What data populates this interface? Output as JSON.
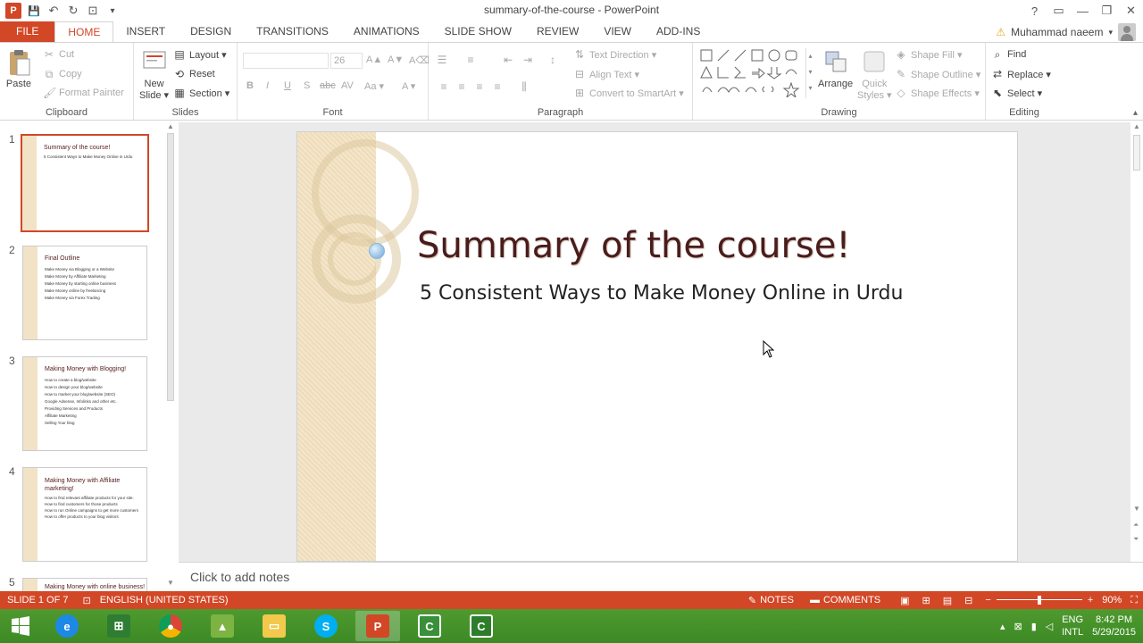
{
  "window": {
    "title": "summary-of-the-course - PowerPoint",
    "help": "?",
    "ribbon_display": "▭",
    "minimize": "—",
    "restore": "❐",
    "close": "✕"
  },
  "qat": {
    "save": "💾",
    "undo": "↶",
    "redo": "↻",
    "presenter": "⊡",
    "customize": "▾"
  },
  "tabs": [
    "FILE",
    "HOME",
    "INSERT",
    "DESIGN",
    "TRANSITIONS",
    "ANIMATIONS",
    "SLIDE SHOW",
    "REVIEW",
    "VIEW",
    "ADD-INS"
  ],
  "user": {
    "warning": "⚠",
    "name": "Muhammad naeem",
    "dropdown": "▾"
  },
  "ribbon": {
    "clipboard": {
      "label": "Clipboard",
      "paste": "Paste",
      "cut": "Cut",
      "copy": "Copy",
      "format_painter": "Format Painter"
    },
    "slides": {
      "label": "Slides",
      "new_slide": "New",
      "new_slide2": "Slide ▾",
      "layout": "Layout ▾",
      "reset": "Reset",
      "section": "Section ▾"
    },
    "font": {
      "label": "Font",
      "size": "26",
      "bold": "B",
      "italic": "I",
      "underline": "U",
      "shadow": "S",
      "strike": "abc",
      "spacing": "AV",
      "case": "Aa ▾",
      "color": "A ▾",
      "grow": "A▲",
      "shrink": "A▼",
      "clear": "A⌫"
    },
    "paragraph": {
      "label": "Paragraph",
      "text_direction": "Text Direction ▾",
      "align_text": "Align Text ▾",
      "smartart": "Convert to SmartArt ▾"
    },
    "drawing": {
      "label": "Drawing",
      "arrange": "Arrange",
      "quick_styles": "Quick",
      "quick_styles2": "Styles ▾",
      "shape_fill": "Shape Fill ▾",
      "shape_outline": "Shape Outline ▾",
      "shape_effects": "Shape Effects ▾"
    },
    "editing": {
      "label": "Editing",
      "find": "Find",
      "replace": "Replace ▾",
      "select": "Select ▾"
    }
  },
  "thumbnails": [
    {
      "num": "1",
      "title": "Summary of the course!",
      "lines": [
        "5 Consistent Ways to Make Money Online in Urdu"
      ]
    },
    {
      "num": "2",
      "title": "Final Outline",
      "lines": [
        "Make Money via Blogging or a Website",
        "Make Money by Affiliate Marketing",
        "Make Money by starting online business",
        "Make Money online by freelancing",
        "Make Money via Forex Trading"
      ]
    },
    {
      "num": "3",
      "title": "Making Money with Blogging!",
      "lines": [
        "How to create a blog/website",
        "How to design your blog/website",
        "How to market your blog/website (SEO)",
        "Google Adsense, Infolinks and other etc.",
        "Providing Services and Products",
        "Affiliate Marketing",
        "Selling Your blog"
      ]
    },
    {
      "num": "4",
      "title": "Making Money with Affiliate marketing!",
      "lines": [
        "How to find relevant affiliate products for your site.",
        "How to find customers for those products",
        "How to run Online campaigns to get more customers",
        "How to offer products to your blog visitors"
      ]
    },
    {
      "num": "5",
      "title": "Making Money with online business!",
      "lines": []
    }
  ],
  "slide": {
    "title": "Summary of the course!",
    "subtitle": "5 Consistent Ways to Make Money Online in Urdu"
  },
  "notes": {
    "placeholder": "Click to add notes"
  },
  "status": {
    "slide_info": "SLIDE 1 OF 7",
    "language": "ENGLISH (UNITED STATES)",
    "notes": "NOTES",
    "comments": "COMMENTS",
    "zoom": "90%",
    "zoom_minus": "−",
    "zoom_plus": "+"
  },
  "taskbar": {
    "lang": "ENG",
    "lang2": "INTL",
    "time": "8:42 PM",
    "date": "5/29/2015"
  }
}
